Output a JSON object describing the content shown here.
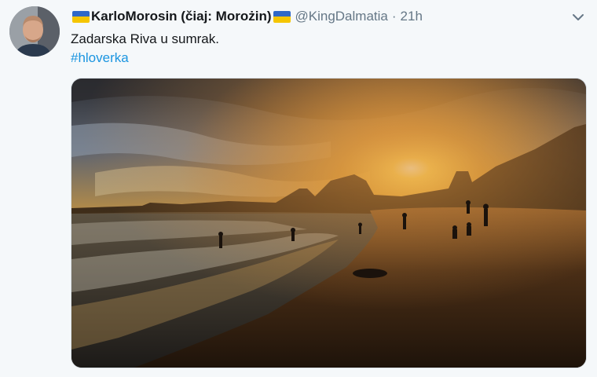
{
  "tweet": {
    "display_name": "KarloMorosin (čiaj: Morożin)",
    "handle": "@KingDalmatia",
    "separator": "·",
    "time": "21h",
    "text": "Zadarska Riva u sumrak.",
    "hashtag": "#hloverka"
  },
  "icons": {
    "caret": "chevron-down-icon",
    "flag": "ukraine-flag-icon"
  },
  "colors": {
    "background": "#f5f8fa",
    "name": "#14171a",
    "meta": "#657786",
    "link": "#1b95e0",
    "flag_blue": "#2f68c8",
    "flag_yellow": "#f5c500"
  }
}
